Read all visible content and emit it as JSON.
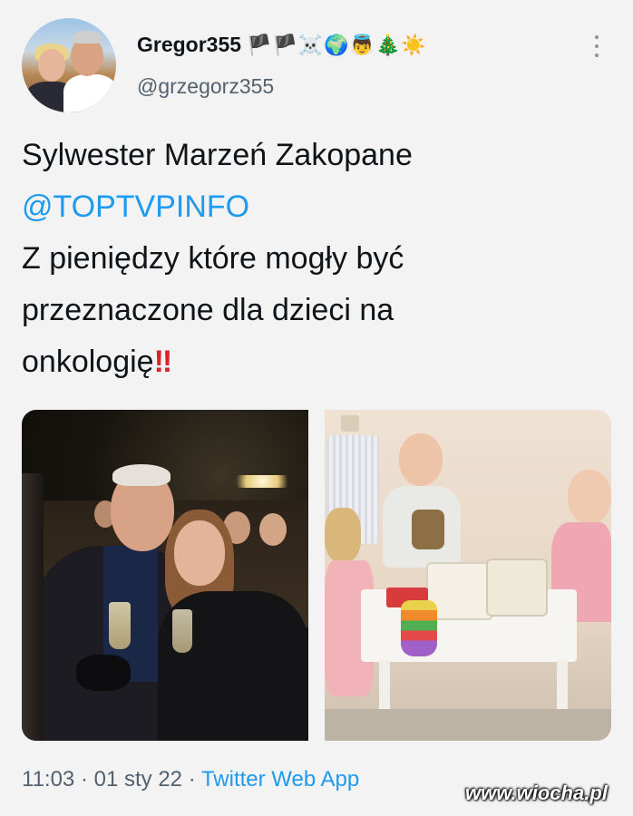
{
  "author": {
    "display_name": "Gregor355",
    "badges": "🏴🏴☠️🌍👼🎄☀️",
    "handle": "@grzegorz355"
  },
  "tweet": {
    "line1": "Sylwester Marzeń Zakopane",
    "mention": "@TOPTVPINFO",
    "line3": "Z pieniędzy które mogły być",
    "line4": "przeznaczone dla dzieci na",
    "line5": "onkologię",
    "emphasis": "!!"
  },
  "meta": {
    "time": "11:03",
    "date": "01 sty 22",
    "separator": "·",
    "source": "Twitter Web App"
  },
  "watermark": "www.wiocha.pl",
  "colors": {
    "link": "#1d9bf0",
    "text": "#0f1419",
    "muted": "#53616e",
    "background": "#f3f3f3"
  }
}
